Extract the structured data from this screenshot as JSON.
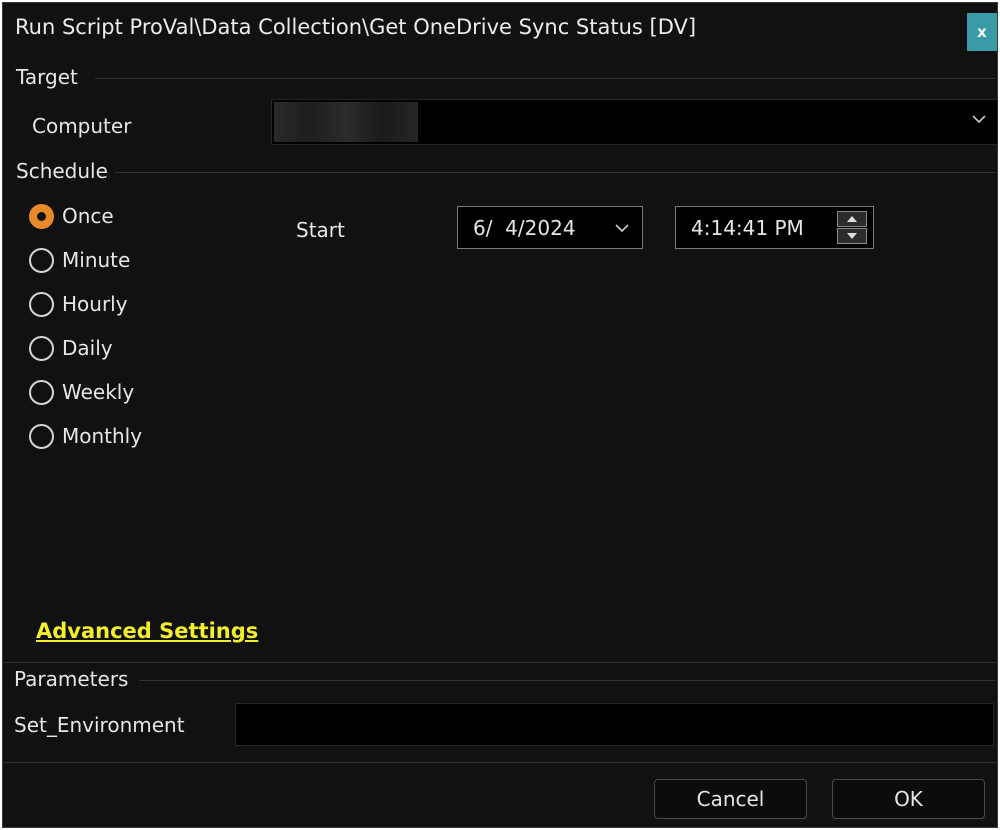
{
  "window": {
    "title": "Run Script ProVal\\Data Collection\\Get OneDrive Sync Status [DV]",
    "close_label": "x",
    "accent": "#3a9aa6"
  },
  "target": {
    "group_label": "Target",
    "computer_label": "Computer",
    "computer_value": ""
  },
  "schedule": {
    "group_label": "Schedule",
    "options": [
      {
        "label": "Once",
        "checked": true
      },
      {
        "label": "Minute",
        "checked": false
      },
      {
        "label": "Hourly",
        "checked": false
      },
      {
        "label": "Daily",
        "checked": false
      },
      {
        "label": "Weekly",
        "checked": false
      },
      {
        "label": "Monthly",
        "checked": false
      }
    ],
    "start_label": "Start",
    "start_date": "6/  4/2024",
    "start_time": "4:14:41 PM",
    "radio_accent": "#e88a2a"
  },
  "advanced_settings_label": "Advanced Settings",
  "parameters": {
    "group_label": "Parameters",
    "field_label": "Set_Environment",
    "field_value": ""
  },
  "buttons": {
    "cancel_label": "Cancel",
    "ok_label": "OK"
  },
  "icons": {
    "dropdown": "chevron-down-icon",
    "spin_up": "triangle-up-icon",
    "spin_down": "triangle-down-icon",
    "close": "close-icon"
  }
}
